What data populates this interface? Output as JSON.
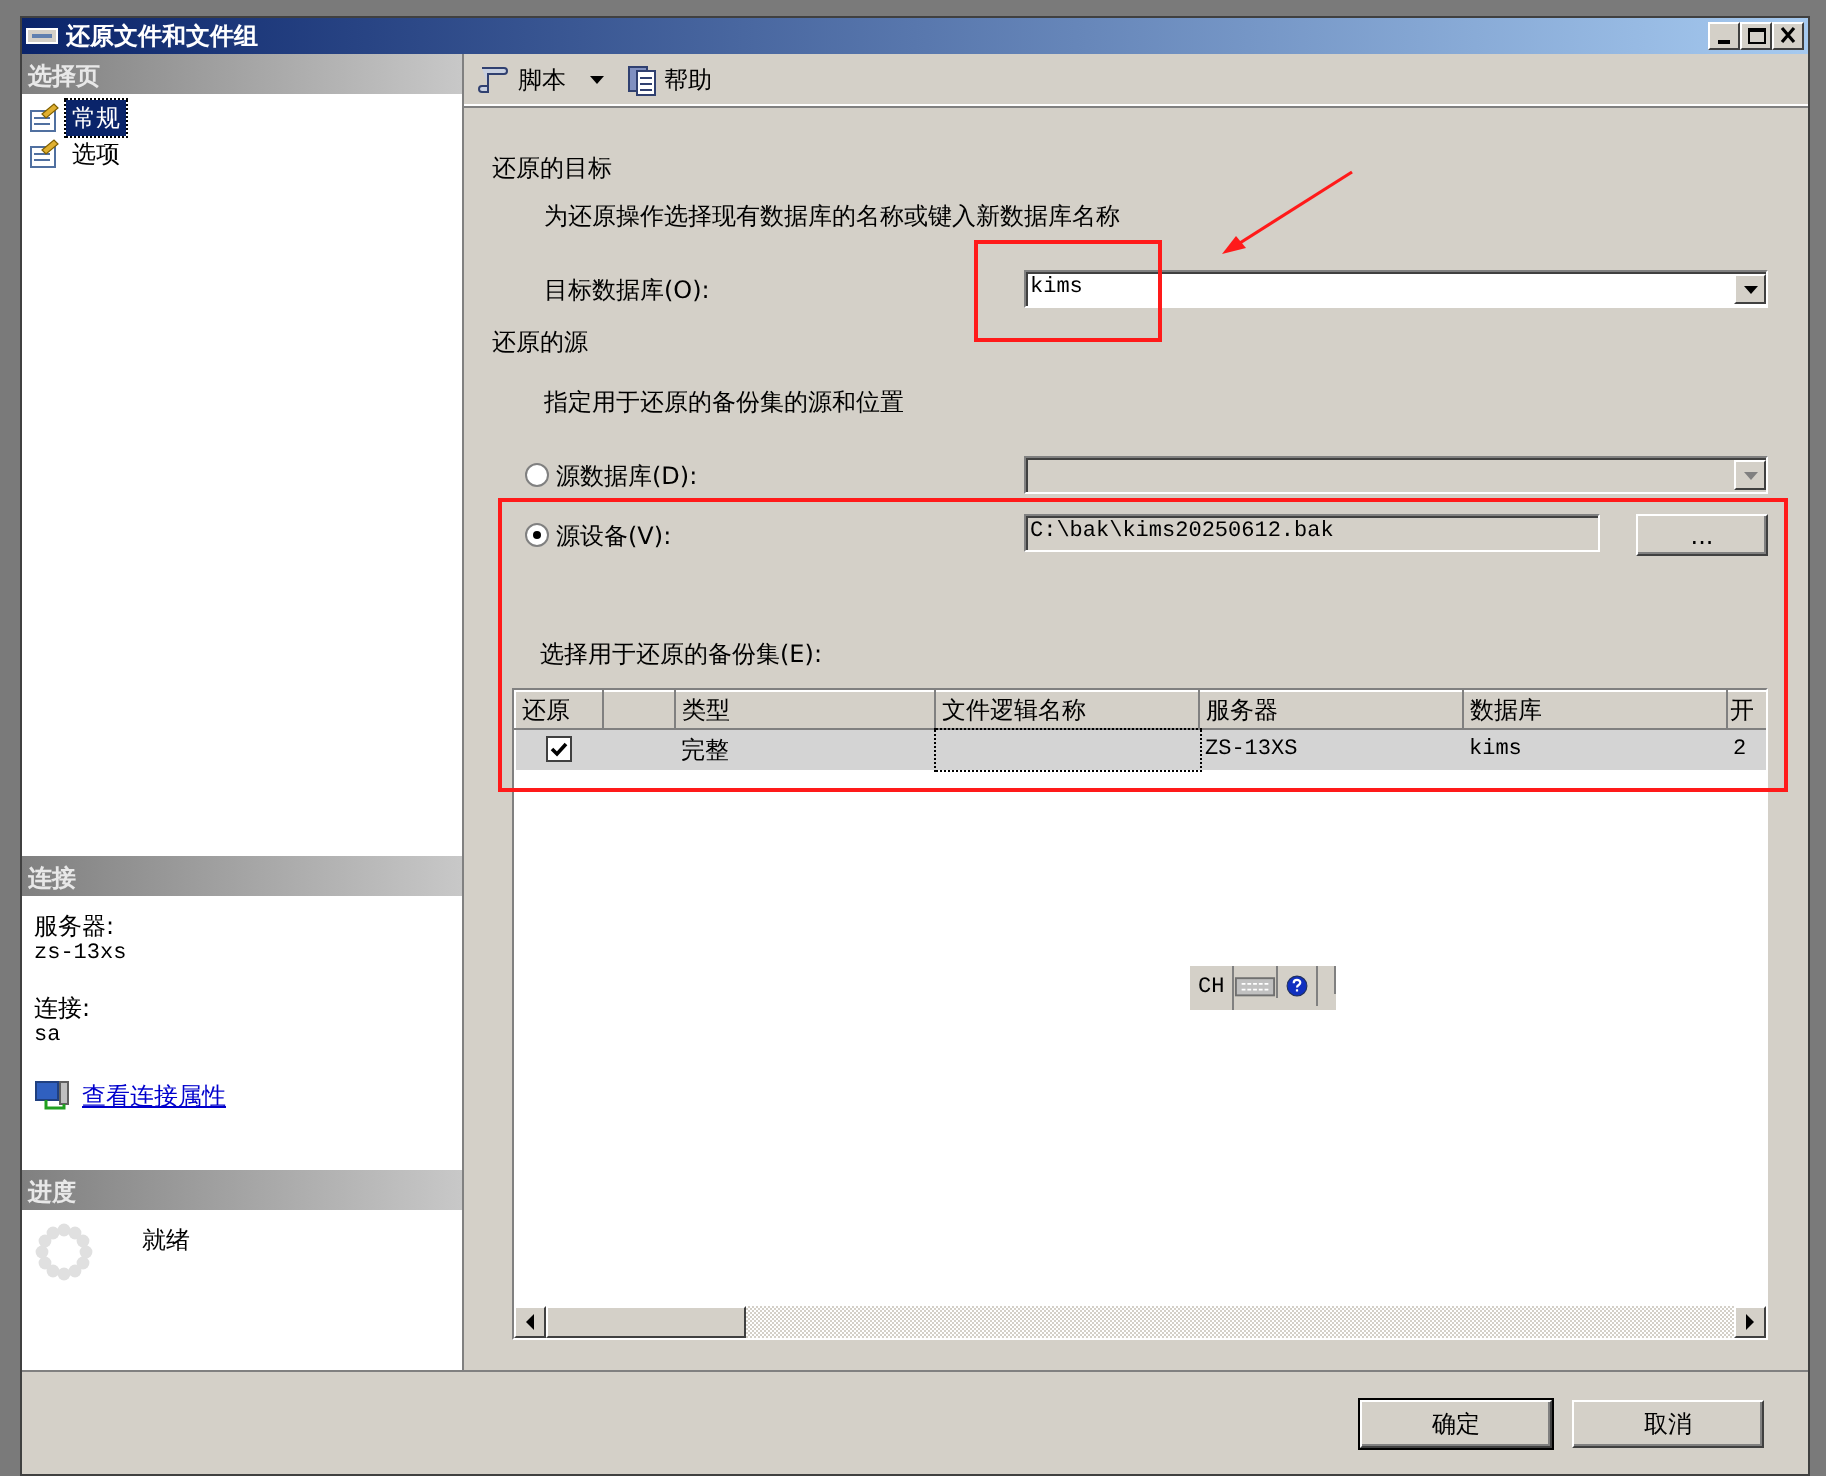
{
  "window": {
    "title": "还原文件和文件组"
  },
  "sidebar": {
    "header": "选择页",
    "pages": [
      {
        "label": "常规",
        "selected": true
      },
      {
        "label": "选项",
        "selected": false
      }
    ]
  },
  "connection": {
    "header": "连接",
    "fields": [
      {
        "label": "服务器:",
        "value": "zs-13xs"
      },
      {
        "label": "连接:",
        "value": "sa"
      }
    ],
    "link": "查看连接属性"
  },
  "progress": {
    "header": "进度",
    "status": "就绪"
  },
  "toolbar": [
    {
      "label": "脚本",
      "kind": "dropdown"
    },
    {
      "label": "帮助",
      "kind": "help"
    }
  ],
  "destination": {
    "heading": "还原的目标",
    "hint": "为还原操作选择现有数据库的名称或键入新数据库名称",
    "label": "目标数据库(O):",
    "value": "kims"
  },
  "source": {
    "heading": "还原的源",
    "hint": "指定用于还原的备份集的源和位置",
    "options": [
      {
        "label": "源数据库(D):",
        "selected": false,
        "kind": "dropdown",
        "disabled": true
      },
      {
        "label": "源设备(V):",
        "selected": true,
        "kind": "file",
        "value": "C:\\bak\\kims20250612.bak",
        "button": "..."
      }
    ]
  },
  "backup_sets": {
    "label": "选择用于还原的备份集(E):",
    "columns": [
      {
        "label": "还原"
      },
      {},
      {
        "label": "类型"
      },
      {
        "label": "文件逻辑名称"
      },
      {
        "label": "服务器"
      },
      {
        "label": "数据库"
      },
      {
        "label": "开"
      }
    ],
    "rows": [
      {
        "checked": true,
        "selected": true,
        "cells": [
          "",
          "",
          "完整",
          "",
          "ZS-13XS",
          "kims",
          "2"
        ]
      }
    ]
  },
  "buttons": [
    {
      "label": "确定",
      "default": true
    },
    {
      "label": "取消",
      "default": false
    }
  ],
  "ime_bar": {
    "label": "CH"
  }
}
